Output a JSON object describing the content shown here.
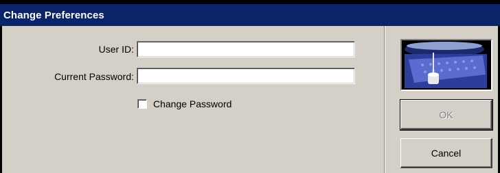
{
  "window": {
    "title": "Change Preferences"
  },
  "form": {
    "user_id_label": "User ID:",
    "user_id_value": "",
    "password_label": "Current Password:",
    "password_value": "",
    "change_password_label": "Change Password",
    "change_password_checked": false
  },
  "buttons": {
    "ok_label": "OK",
    "cancel_label": "Cancel",
    "ok_enabled": false
  },
  "icons": {
    "logo": "product-logo-image"
  },
  "colors": {
    "title_bar": "#0a246a",
    "window_bg": "#d4d0c8"
  }
}
